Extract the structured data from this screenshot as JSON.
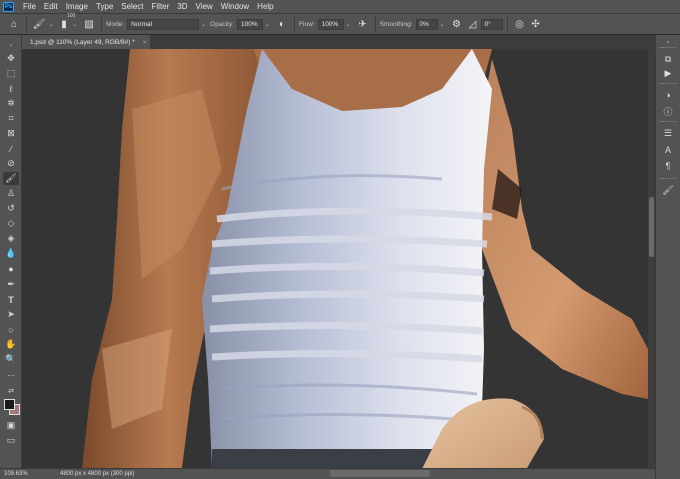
{
  "app": {
    "logo": "Ps"
  },
  "menu": [
    "File",
    "Edit",
    "Image",
    "Type",
    "Select",
    "Filter",
    "3D",
    "View",
    "Window",
    "Help"
  ],
  "options": {
    "brush_size": "100",
    "mode_label": "Mode:",
    "mode_value": "Normal",
    "opacity_label": "Opacity:",
    "opacity_value": "100%",
    "flow_label": "Flow:",
    "flow_value": "100%",
    "smoothing_label": "Smoothing:",
    "smoothing_value": "0%",
    "angle_value": "0°"
  },
  "document": {
    "tab_title": "1.psd @ 110% (Layer 49, RGB/8#) *",
    "close_glyph": "×"
  },
  "status": {
    "zoom": "109.63%",
    "doc_info": "4800 px x 4800 px (300 ppi)"
  },
  "colors": {
    "foreground": "#1a1a1a",
    "background": "#a07a78",
    "accent": "#31a8ff"
  },
  "tools": [
    "move-tool-icon",
    "marquee-tool-icon",
    "lasso-tool-icon",
    "magic-wand-icon",
    "crop-tool-icon",
    "frame-tool-icon",
    "eyedropper-icon",
    "healing-brush-icon",
    "brush-tool-icon",
    "clone-stamp-icon",
    "history-brush-icon",
    "eraser-icon",
    "paint-bucket-icon",
    "blur-tool-icon",
    "dodge-tool-icon",
    "pen-tool-icon",
    "type-tool-icon",
    "path-selection-icon",
    "shape-tool-icon",
    "hand-tool-icon",
    "zoom-tool-icon"
  ]
}
